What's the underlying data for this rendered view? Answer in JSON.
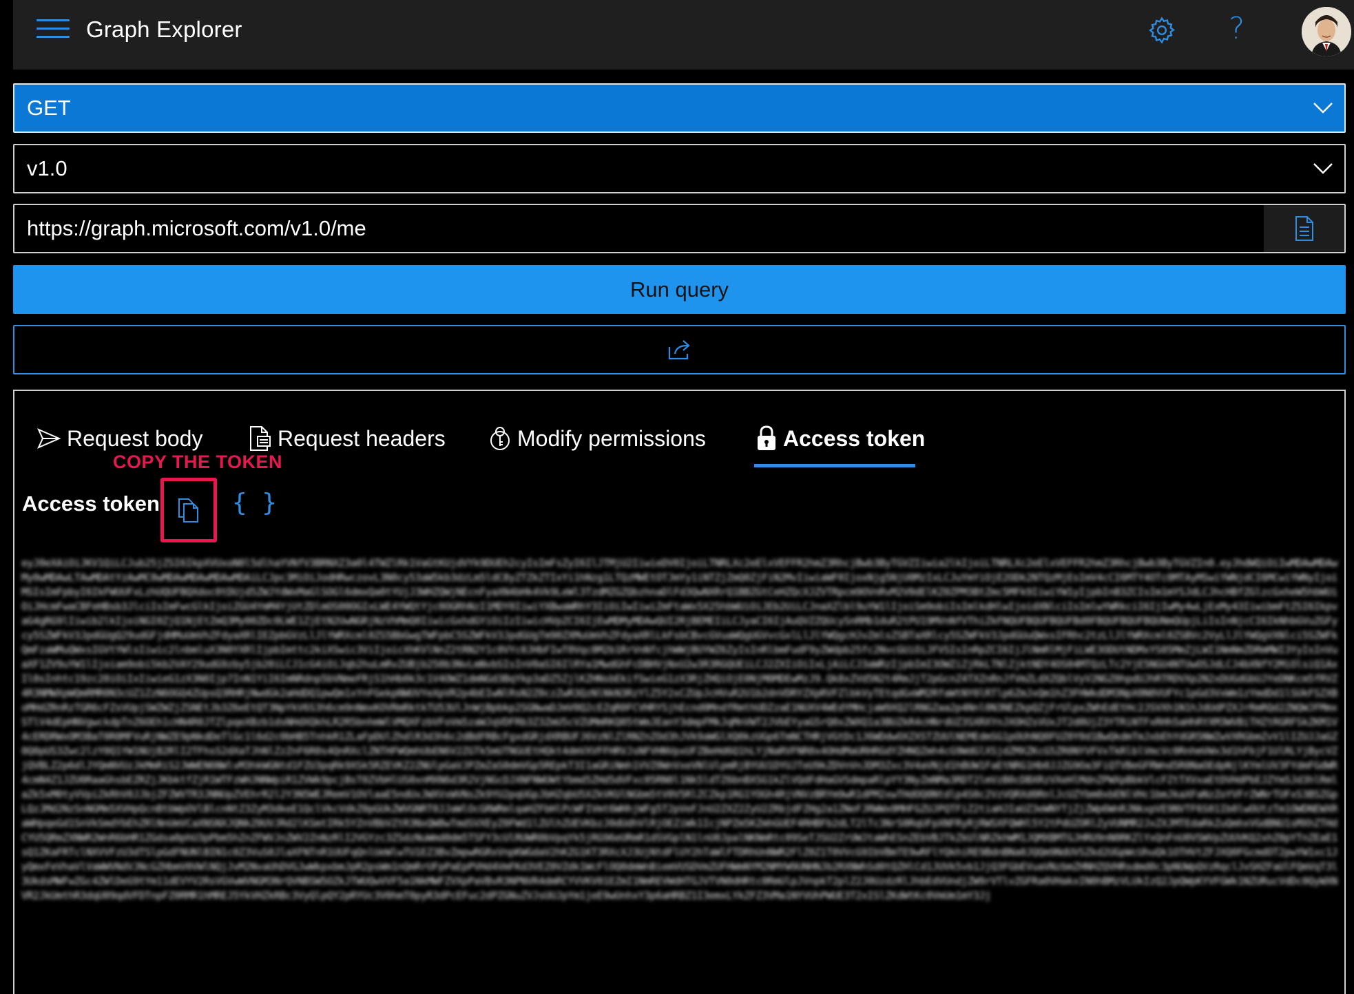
{
  "app": {
    "title": "Graph Explorer"
  },
  "header": {
    "settings_icon": "gear-icon",
    "help_glyph": "?",
    "avatar_icon": "user-avatar"
  },
  "query": {
    "method": "GET",
    "version": "v1.0",
    "url": "https://graph.microsoft.com/v1.0/me",
    "run_label": "Run query"
  },
  "tabs": [
    {
      "label": "Request body",
      "icon": "send-icon"
    },
    {
      "label": "Request headers",
      "icon": "document-icon"
    },
    {
      "label": "Modify permissions",
      "icon": "permission-icon"
    },
    {
      "label": "Access token",
      "icon": "lock-icon",
      "selected": true
    }
  ],
  "annotation": {
    "text": "COPY THE TOKEN",
    "color": "#e8174f"
  },
  "token_panel": {
    "heading": "Access token",
    "braces": "{ }",
    "token_value": "eyJ0eXAiOiJKV1QiLCJub25jZSI6IkpXVUxoN0l5dlhaYVNfV3BRNXZ3a0l4TWZlRk1VaGtKUjdVYk9DUEh2cyIsImFsZyI6IlJTMjU2IiwieDV0IjoiLTNRLXc2eElxVEFFR2hmZ3RhcjBwb3ByTGVZIiwia2lkIjoiLTNRLXc2eElxVEFFR2hmZ3RhcjBwb3ByTGVZIn0.eyJhdWQiOiIwMDAwMDAwMy0wMDAwLTAwMDAtYzAwMC0wMDAwMDAwMDAwMDAiLCJpc3MiOiJodHRwczovL3N0cy53aW5kb3dzLm5ldC8yZTZkZTIxYi1hNzg1LTQzMWEtOTJmYy1iNTZjZmQ0ZjFiN2MvIiwiaWF0IjoxNjg5NjU0MzIxLCJuYmYiOjE2ODk2NTQzMjEsImV4cCI6MTY4OTc0MTAyMSwiYWNjdCI6MCwiYWNyIjoiMSIsImFpbyI6IkFWUUFxLzhUQUFBQXdoc0tDUjd5ZWJYdWxMaGlSOGl6dmxQa0tYUjJ3WHZQWjNEcnFyaXN4bHk4Vk9LeWl3TzdMZGZQbzhnaDlFd3QwNXRrQ1BBZGtCeHZQcXJZVTRpcm9OVnRvM2V0dElKZ0ZPM3BtZmc5MFk9IiwiYW1yIjpbInB3ZCIsIm1mYSJdLCJhcHBfZGlzcGxheW5hbWUiOiJHcmFwaCBFeHBsb3JlciIsImFwcGlkIjoiZGU4YmM4YjUtZDlmOS00OGIxLWE4YWQtYjc0OGRhNzI1MDY0IiwiYXBwaWRhY3IiOiIwIiwiZmFtaWx5X25hbWUiOiJEb2UiLCJnaXZlbl9uYW1lIjoiSm9obiIsImlkdHlwIjoidXNlciIsImlwYWRkciI6IjIwMy4wLjExMy43IiwibmFtZSI6IkpvaG4gRG9lIiwib2lkIjoiNGI0ZjQ1NjEtZmQ3My00ZDc0LWE1ZjEtN2UwNGRjNzVhMmQ0IiwicGxhdGYiOiIzIiwicHVpZCI6IjEwMDMyMDAwQUI2RjBEMEIiLCJyaCI6IjAuQVZZQUcySnRMb1duR2tPU19MVnNfVThiZkFNQUFBQUFBQUFBd0FBQUFBQUFBQUNmQUpjLiIsInNjcCI6IkNhbGVuZGFycy5SZWFkV3JpdGUgQ29udGFjdHMuUmVhZFdyaXRlIEZpbGVzLlJlYWRXcml0ZS5BbGwgTWFpbC5SZWFkV3JpdGUgTm90ZXMuUmVhZFdyaXRlLkFsbCBvcGVuaWQgUGVvcGxlLlJlYWQgcHJvZmlsZSBTaXRlcy5SZWFkV3JpdGUuQWxsIFRhc2tzLlJlYWRXcml0ZSBVc2VyLlJlYWQgVXNlci5SZWFkQmFzaWMuQWxsIGVtYWlsIiwic2lnbmluX3N0YXRlIjpbImttc2kiXSwic3ViIjoicXhKVlNnZ2tRN2Y1c0VYc0JHbFIwT0Vqc0M2b1RrVnNfcjhWWjBUYWZ6ZyIsInRlbmFudF9yZWdpb25fc2NvcGUiOiJFVSIsInRpZCI6IjJlNmRlMjFiLWE3ODUtNDMxYS05MmZjLWI1NmNmZDRmMWI3YyIsInVuaXF1ZV9uYW1lIjoiam9obi5kb2VAY29udG9zby5jb20iLCJ1cG4iOiJqb2huLmRvZUBjb250b3NvLmNvbSIsInV0aSI6IlRYa1MwdGhFcDBHVjNxU2w3R3RGQUEiLCJ2ZXIiOiIxLjAiLCJ3aWRzIjpbImI3OWZiZjRkLTNlZjktNDY4OS04MTQzLTc2YjE5NGU4NTUwOSJdLCJ4bXNfY2MiOlsiQ1AxIl0sInhtc19zc20iOiIxIiwieG1zX3N0Ijp7InN1YiI6ImNRdnp5bVNmeFRjS1hHb0k3c1V4OWZ1dmNGd3BqYkp3aDZ5ZjlKZHNsbEkifSwieG1zX3RjZHQiOjE0NjM0MDEwMzJ9.Qk8xZVd5N2t4RmJjT2pGcnZ4TXZnRnJfVmZLdXZQblVyV2NGZ0hpdUJhRTRDVXp2N2xDUGdGbUJYeDNKcm5fRVZ4R3NMWXpWQmRMR0N3cUZ1ZzN6OGQ4ZUpsQ3RHRjNwdGk2aHdDQ1pwQm1xYnFGekpNWUVYeXpVR2p4bEIwNlRsN2Z0czZwR3QzNlNkN3RzYlZ5Y2xCZUpJcHVuR2U1b2dnVDRYZXpRVFZlbkVyTEtqdGxWM2RfaWtNY0lRTlp6ZmJxQm1hZ3FHWkdDM3NpX0N0VUFYc1pGd3VxWm1zYmdDd1lSUkFSZXBoMHdZRnRzTGR6cFZsVUpjSWZWZjZSNEtJb3Z6eEtQT3NpYkV6S3h6cm9nNmxKOVRmRktkTU53UlJnWjBpbkp2SGNwaDJmV0Q2cEZqR0FCVHRYSjhEcnd0MndfRmthUDZzaE1NUXV4WEdYMHcjaW9XQ2lRNGZaa2p4Nnl0N3NEZkpQZjFrUlpxZWhEdEtHc2JSVXh1N1hJdUdPZXJrRmRQd2ZNQWJFMmxSTlV4dEpHNVgwckdpTnZ6OEh1cHN4R0JTZlpqeXBzb1dsNHdXQkhLR2R5bnhmWlVMQXFzbVFoVm5zaWJqVDFRb3Z3ZmU5cVZUMmRKQ05tWmJEanY3dmpFMkJqMnVWT2JVbEYyaG5rQ0xZWXQ1a3BUZkR4cHNrdUZ3SXRXYnJXOHZsVUxJT2d0UjZ3YTRiNTFxRHh5aHhRYXM3WVBiTHZtRGRFSkZKM1V4cERDRWxOM3BaT0R0MFVuRjNWZE9pNkdDeTlGc1l6d2c0bHB5TnhkR1ZLaFpDUlZhdlR3d3h6c2dBdFRBcFgxdGRjdXRBUFJ6VzNlZlRNZnZOd3hJVk9aWGlXQ0kzUGp6TmNCTHRjVGtDc1J6WDdwOXZXSTZUUlNEMEdmSG1pOUhNQ0FUZ0Y0d1BwQkdmTmJxbEhYdGR5NWZwVXRGbmZvV1lIZUJJaGZ0Q0pUS3Zwc2lzY0Q1YW1NUjB2RlI2TFhsS2dXaTJhNlZzZnF6R0s4QnRXclZNTHFWQmhUbEN6V2ZGTk5mUTNGUEtHQkt4dmVXVFFHRVJsNFVHNVpxUFZBeHd6Q1hLYjNaRVFNR0x4OHdMaURHRGdYZHNQZmh4cG9WdGlXSjdZMXZKcG5ZR0NYVFVxTkRlblVmcVc0RnhmVWx3d1hFbjF1UlRLYjBycVZjQVBLZ2p6dlJYQmNVUzJkMmRiS2JWWEN6NWlvM3hkWGNtd1FZU3pqRk9XSk5RZEVKZ2ZNUlpGaVJPZmZaS0dmVGp5REpkT3I1aGRiNmh1VVZ0WnVxeVNlUlpmRjBYUU1DYUJTeU9kZDVnVnJDM3Zxc3V4aVNjd1hBUW1FaEtNRG1Hb0JJZG9Oa3FiQTVBeGFRWnd5R0NaOEdpNjlKYmlUV3FYdmFGdWR4cmN4Z1JZU0RaaGhsbEZRZjJKbktfZjR1WTFzWHJNNWpiR1ZVWk9pcjBsT0ZVbHlUS0xnMXN6d3R2VjNGcDJXNFNWUWtYbmd5ZHd5dVFxc05RN0l1Nk5ldTZ6bnBXSG1kZlVQdFdHaGVSdmpaRlpYY3NyZmNMa3RDT2lmVzB0cDBXRzVXeHlMdnZPWXpBbkVlcFZtTXVxaEtDVHdPbEJZYm5Jd3hlRmlaZk5xM0tyVVpiZkRhV0JJbjZFZWVTR3JNNUpZVEhrR2l2Y3N5WEJRemV1OVlaaE5ndUxJWXVxWVNsZk9YU2pqUGpJbHZqbU5XZkVKUlNGbm5tV0V5RlZCZkp1RG1YOGh4RjVNVzBRYm9wR1dPM2xwTHdOQ0Ntdlp4S0c2VzVQRXd0RnlJcUZYbm0xbENlVHc1bmJkaXFaNzZoYVFrZWNrTUFxS3BSZGpLQzJMd2NzSnNGMm5XVHpQcnBtbWpOVlBlcnNtZ3ZyM3dkeE1QclVkcVdkZ0pGUkZWVGNRT0JJaWlOcGRWRmlqaHZFbHlPcWFIVmt6WHhjWFg5T2pVeFJnU2ZXZ2ZyU2ZRbjdFZHg2a1ZNeFJRWWx0MHFGZUJPQTFiZ2tiaHJIaUZ3eWNYTjZjZWp6WnRJNkxpVE9NVTF6S01Ib0lwOUtzTm1OWDNEWXRaWHpqeGd1SnVkSmdYbEhZRlNnUmVCaXNSNXJQNkZ0UVJRd2lKSmtIRk5YZnVBbVZtR3NxQW8wTmdSVXEyZ0FWd1lZUlhZUEVKbzJ0dUdhVlRjOEZiWk1IcjNPZm5KZmhGUEF4RHBFb2dLT2lTc3NrS0RqUFpXNFRyRjRWSXFQWHl5Y2tPdUZORlZyVUNMR2JxZXJMTEdaRkZuQmhxVGdBNU1sMXhZTHdCYU5QRmZXNWR2WnR6bHR1ZGdsa0phU3pPbm5hZnZFWVJnZWV2ZnNzRlI2VGYzc3ZSdzNuWmd0dm5TSFY3cUlRUWR0bVpqYk5jRG96eURmR1dSVGplN1lnU0JpalNKNmRtc09SeTJSU2ZrUWJtaWhESnZEbVBJTkZkUlNRZkhWM1JQMXBMTGJHRU9nN0RKZlYxQnFnU0VSWVpZUUVKQ2xhZ0pYTnZEaE1sQ1ZKaFRTclNXVVFzU3dTSlpGdFNUNlBIN1c0Z3VuS0JlaXFNTnR1UUFqQnlUeWlwTU1EZ3BvZmpwRGRxVnpKWGdaV2hKZG1KT3RXcXJ3UjNtdFlUY2hTaWlFTDRhUnNWR2FlZ0Z1T0VVcG9IbVBmTE9wRFlYQkhiRE9BdnBNa0JQQm9NdUVSZkd2UGpWcUhuQk1OTHVtZFJXQ0FGcmdOT2pwYW1xc1JyQmxFeVhaVlVaWWVNdVJNcGZHbmV0VWlNQjJvM2NvaUhDVGJwWkpxbmJpR2psWm1nQmRrUFpPaEpPVHd4VmFKd3VEZ0VZdk1WcFlOQ0dmWnBiemVUSDVmZUFHWmNYM2NMYW9UNHNJb2RXNWhSd0tQZHlCd1JUVk5vb1JjQ3FGbEVuaVNzbmZHNHZQVHRsdmd0c3pNUWpQVzRqclJvSHZFaUlFQmVqT3l3UkdsMWFwZGc4ZWlDeG9tYm11dEVYV2RsVGVwWVNGM3NrQVNBSW5OZkJTWUQwVVF5a1NkMWFZVXpPaVBvR3NPNVR4dmRCYVVKV01EZmI1NmREVWdHTGJVTVN0dHRtc0RmUlpJVnpkT2plZ2J0UzdzRlJhbEdVUndjZW9rVTlvZGFRa0VHakxIN0hBMzVLUkIzQ2JpQWpKYVFGWk1NZURucVdDc0QyWXNVR2JkUmthR3dqU09qdVFDTnpFZ0RMR1hMREJ5YkVHZkRBc3VyQlpQY2pRYUc3V0hmT0pyR3dPcEFuc2dPZGNuZVJsUUJpYm1jeE9wUnhxY3p6aHRBZ1I3emxLYkZFZ3VMa1NYVUhPWUE3T2xISlZKdWtKc0VmUm1mY3Jj"
  },
  "colors": {
    "accent": "#2f8de4",
    "method_bg": "#0a78d4",
    "run_bg": "#1f94ef",
    "annotation": "#e8174f"
  }
}
